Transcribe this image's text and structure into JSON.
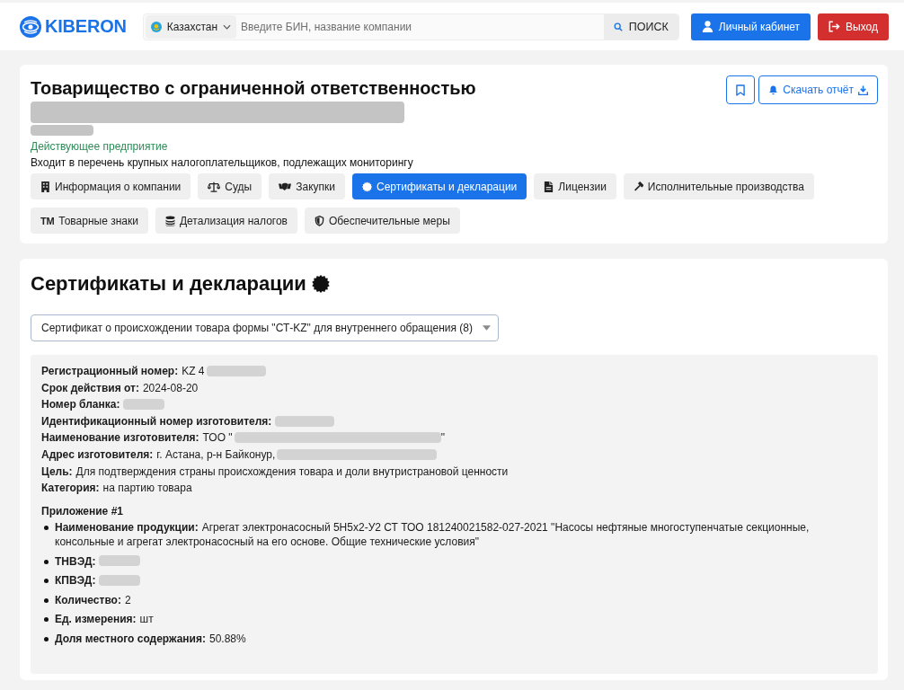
{
  "header": {
    "logo": "KIBERON",
    "country": "Казахстан",
    "search": {
      "placeholder": "Введите БИН, название компании"
    },
    "search_button": "ПОИСК",
    "account_button": "Личный кабинет",
    "logout_button": "Выход"
  },
  "company": {
    "legal_form": "Товарищество с ограниченной ответственностью",
    "blurred_lines": [
      {
        "kind": "heading"
      },
      {
        "kind": "caption"
      }
    ],
    "status": "Действующее предприятие",
    "note": "Входит в перечень крупных налогоплательщиков, подлежащих мониторингу",
    "download_button": "Скачать отчёт",
    "tabs": [
      {
        "label": "Информация о компании",
        "selected": false
      },
      {
        "label": "Суды",
        "selected": false
      },
      {
        "label": "Закупки",
        "selected": false
      },
      {
        "label": "Сертификаты и декларации",
        "selected": true
      },
      {
        "label": "Лицензии",
        "selected": false
      },
      {
        "label": "Исполнительные производства",
        "selected": false
      },
      {
        "label": "Товарные знаки",
        "glyph": "TM",
        "selected": false
      },
      {
        "label": "Детализация налогов",
        "selected": false
      },
      {
        "label": "Обеспечительные меры",
        "selected": false
      }
    ]
  },
  "certificates": {
    "title": "Сертификаты и декларации",
    "select": {
      "value": "Сертификат о происхождении товара формы \"СТ-KZ\" для внутреннего обращения (8)"
    },
    "fields": [
      {
        "label": "Регистрационный номер:",
        "value": [
          {
            "kind": "text",
            "text": "KZ 4"
          },
          {
            "kind": "blur_medium"
          }
        ]
      },
      {
        "label": "Срок действия от:",
        "value": [
          {
            "kind": "text",
            "text": "2024-08-20"
          }
        ]
      },
      {
        "label": "Номер бланка:",
        "value": [
          {
            "kind": "blur_short"
          }
        ]
      },
      {
        "label": "Идентификационный номер изготовителя:",
        "value": [
          {
            "kind": "blur_medium"
          }
        ]
      },
      {
        "label": "Наименование изготовителя:",
        "value": [
          {
            "kind": "text",
            "text": "ТОО \""
          },
          {
            "kind": "blur_wide"
          },
          {
            "kind": "text",
            "text": "\""
          }
        ]
      },
      {
        "label": "Адрес изготовителя:",
        "value": [
          {
            "kind": "text",
            "text": "г. Астана, р-н Байконур,"
          },
          {
            "kind": "blur_long"
          }
        ]
      },
      {
        "label": "Цель:",
        "value": [
          {
            "kind": "text",
            "text": "Для подтверждения страны происхождения товара и доли внутристрановой ценности"
          }
        ]
      },
      {
        "label": "Категория:",
        "value": [
          {
            "kind": "text",
            "text": "на партию товара"
          }
        ]
      }
    ],
    "appendix": {
      "title": "Приложение #1",
      "items": [
        {
          "label": "Наименование продукции:",
          "value": [
            {
              "kind": "text",
              "text": "Агрегат электронасосный 5Н5х2-У2 СТ ТОО 181240021582-027-2021 \"Насосы нефтяные многоступенчатые секционные, консольные и агрегат электронасосный на его основе. Общие технические условия\""
            }
          ]
        },
        {
          "label": "ТНВЭД:",
          "value": [
            {
              "kind": "blur_short"
            }
          ]
        },
        {
          "label": "КПВЭД:",
          "value": [
            {
              "kind": "blur_short"
            }
          ]
        },
        {
          "label": "Количество:",
          "value": [
            {
              "kind": "text",
              "text": "2"
            }
          ]
        },
        {
          "label": "Ед. измерения:",
          "value": [
            {
              "kind": "text",
              "text": "шт"
            }
          ]
        },
        {
          "label": "Доля местного содержания:",
          "value": [
            {
              "kind": "text",
              "text": "50.88%"
            }
          ]
        }
      ]
    }
  }
}
